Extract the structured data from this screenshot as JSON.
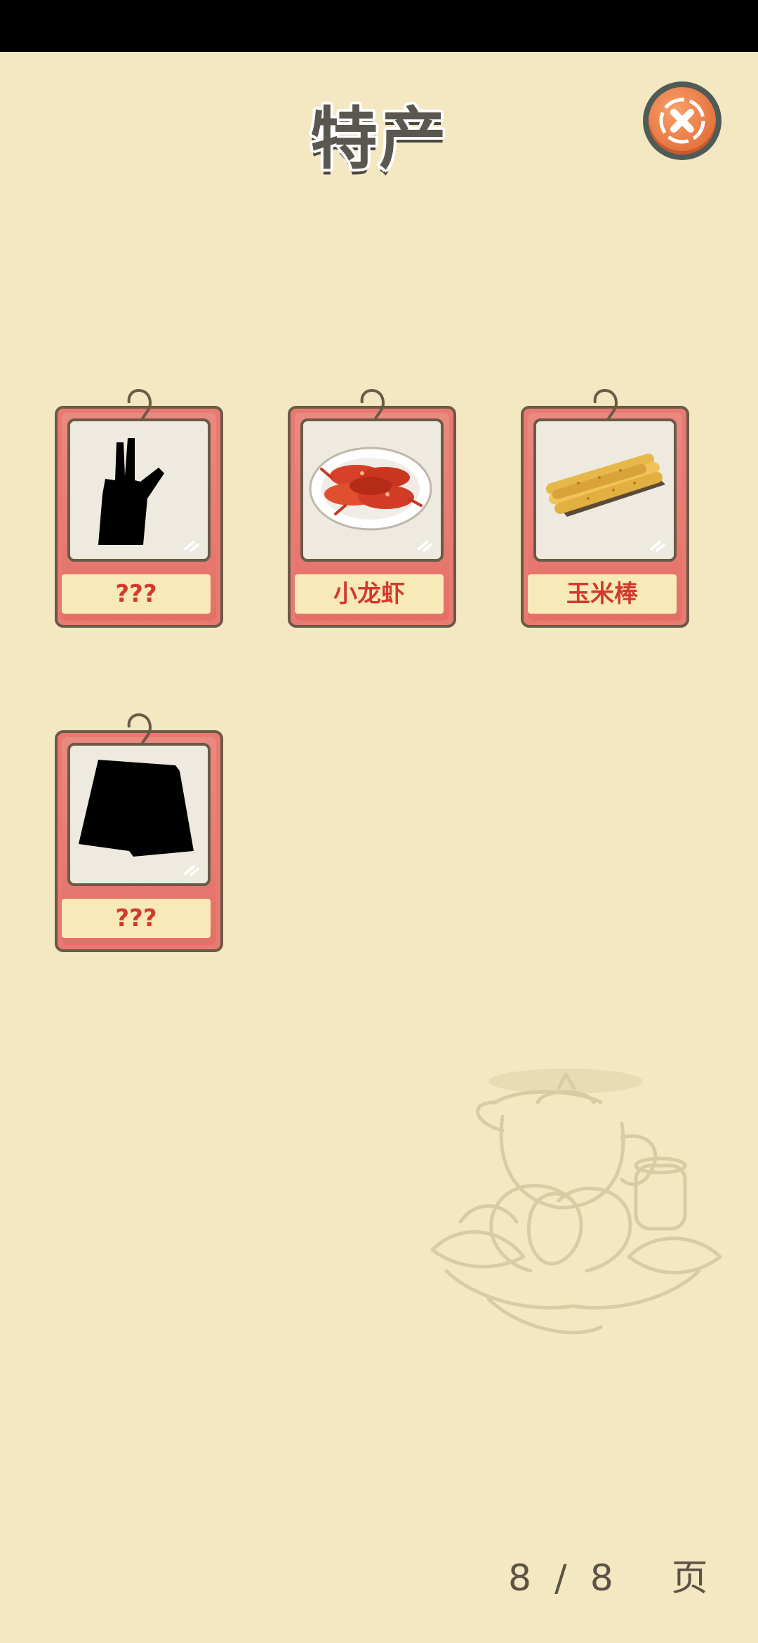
{
  "header": {
    "title": "特产",
    "close_icon": "close-icon"
  },
  "cards": [
    {
      "label": "???",
      "locked": true,
      "icon": "gloves-silhouette"
    },
    {
      "label": "小龙虾",
      "locked": false,
      "icon": "crayfish-plate"
    },
    {
      "label": "玉米棒",
      "locked": false,
      "icon": "corn-sticks"
    },
    {
      "label": "???",
      "locked": true,
      "icon": "cloth-silhouette"
    }
  ],
  "pagination": {
    "current": "8",
    "separator": "/",
    "total": "8",
    "unit": "页"
  },
  "colors": {
    "background": "#f3e8c2",
    "card": "#e87a72",
    "label_text": "#d23a2e",
    "close_button": "#e5733e"
  }
}
